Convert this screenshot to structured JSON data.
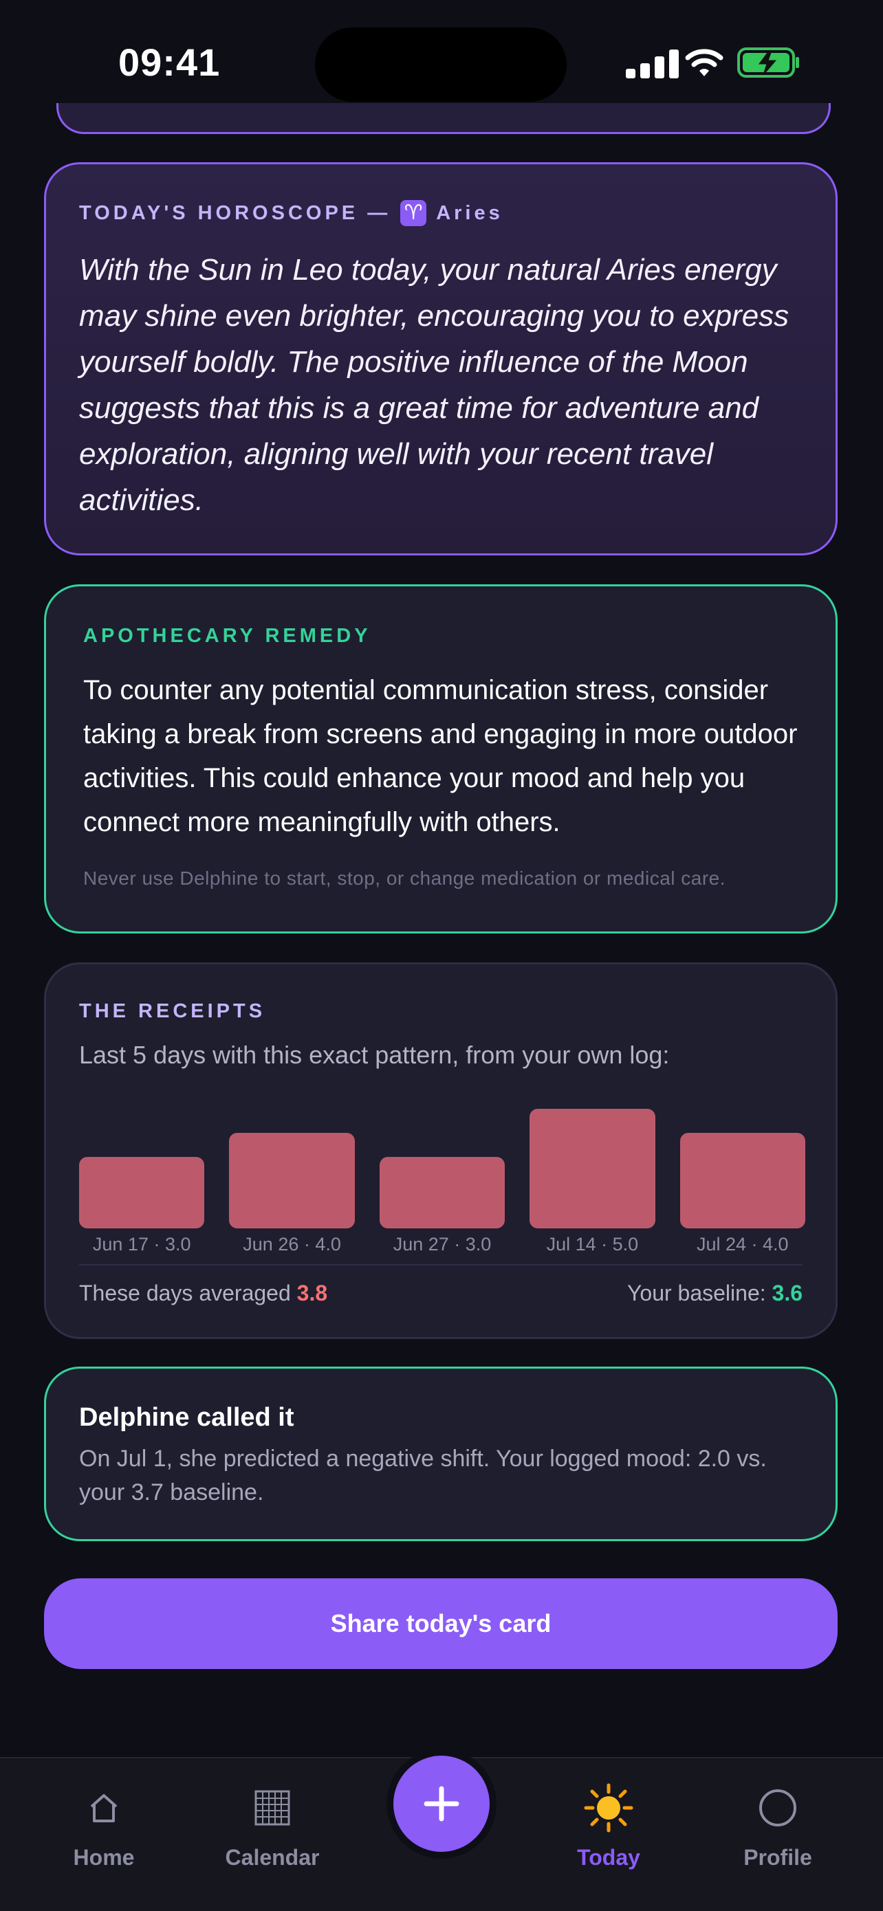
{
  "status_bar": {
    "time": "09:41"
  },
  "horoscope": {
    "label": "TODAY'S HOROSCOPE —",
    "sign_glyph": "♈",
    "sign": "Aries",
    "text": "With the Sun in Leo today, your natural Aries energy may shine even brighter, encouraging you to express yourself boldly. The positive influence of the Moon suggests that this is a great time for adventure and exploration, aligning well with your recent travel activities."
  },
  "remedy": {
    "label": "APOTHECARY REMEDY",
    "text": "To counter any potential communication stress, consider taking a break from screens and engaging in more outdoor activities. This could enhance your mood and help you connect more meaningfully with others.",
    "disclaimer": "Never use Delphine to start, stop, or change medication or medical care."
  },
  "receipts": {
    "label": "THE RECEIPTS",
    "subtitle": "Last 5 days with this exact pattern, from your own log:",
    "days": [
      {
        "label": "Jun 17 · 3.0",
        "value": 3.0
      },
      {
        "label": "Jun 26 · 4.0",
        "value": 4.0
      },
      {
        "label": "Jun 27 · 3.0",
        "value": 3.0
      },
      {
        "label": "Jul 14 · 5.0",
        "value": 5.0
      },
      {
        "label": "Jul 24 · 4.0",
        "value": 4.0
      }
    ],
    "average_prefix": "These days averaged",
    "average_value": "3.8",
    "baseline_prefix": "Your baseline:",
    "baseline_value": "3.6",
    "bar_color": "#bc5a6c"
  },
  "prediction": {
    "title": "Delphine called it",
    "text": "On Jul 1, she predicted a negative shift. Your logged mood: 2.0 vs. your 3.7 baseline."
  },
  "share_button": {
    "label": "Share today's card"
  },
  "tabbar": {
    "tabs": [
      {
        "label": "Home",
        "icon": "home-icon"
      },
      {
        "label": "Calendar",
        "icon": "calendar-icon"
      },
      {
        "label": "Today",
        "icon": "sun-icon",
        "active": true
      },
      {
        "label": "Profile",
        "icon": "profile-icon"
      }
    ],
    "fab_icon": "plus-icon"
  },
  "colors": {
    "accent": "#8b5cf6",
    "mint": "#34d399",
    "background": "#0e0e17",
    "card": "#1e1e2f"
  }
}
